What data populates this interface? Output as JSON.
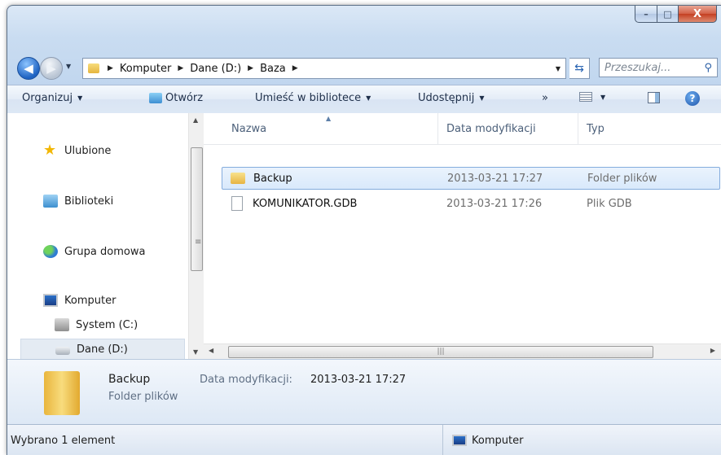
{
  "window": {
    "caption": {
      "minimize": "–",
      "maximize": "□",
      "close": "X"
    }
  },
  "address": {
    "segments": [
      "Komputer",
      "Dane (D:)",
      "Baza"
    ],
    "search_placeholder": "Przeszukaj..."
  },
  "toolbar": {
    "organize": "Organizuj",
    "open": "Otwórz",
    "library": "Umieść w bibliotece",
    "share": "Udostępnij",
    "more": "»"
  },
  "nav": {
    "favorites": "Ulubione",
    "libraries": "Biblioteki",
    "homegroup": "Grupa domowa",
    "computer": "Komputer",
    "drive_c": "System (C:)",
    "drive_d": "Dane (D:)"
  },
  "columns": {
    "name": "Nazwa",
    "date": "Data modyfikacji",
    "type": "Typ"
  },
  "files": [
    {
      "name": "Backup",
      "date": "2013-03-21 17:27",
      "type": "Folder plików",
      "kind": "folder",
      "selected": true
    },
    {
      "name": "KOMUNIKATOR.GDB",
      "date": "2013-03-21 17:26",
      "type": "Plik GDB",
      "kind": "file",
      "selected": false
    }
  ],
  "details": {
    "name": "Backup",
    "type": "Folder plików",
    "date_label": "Data modyfikacji:",
    "date_value": "2013-03-21 17:27"
  },
  "status": {
    "selected": "Wybrano 1 element",
    "location": "Komputer"
  }
}
